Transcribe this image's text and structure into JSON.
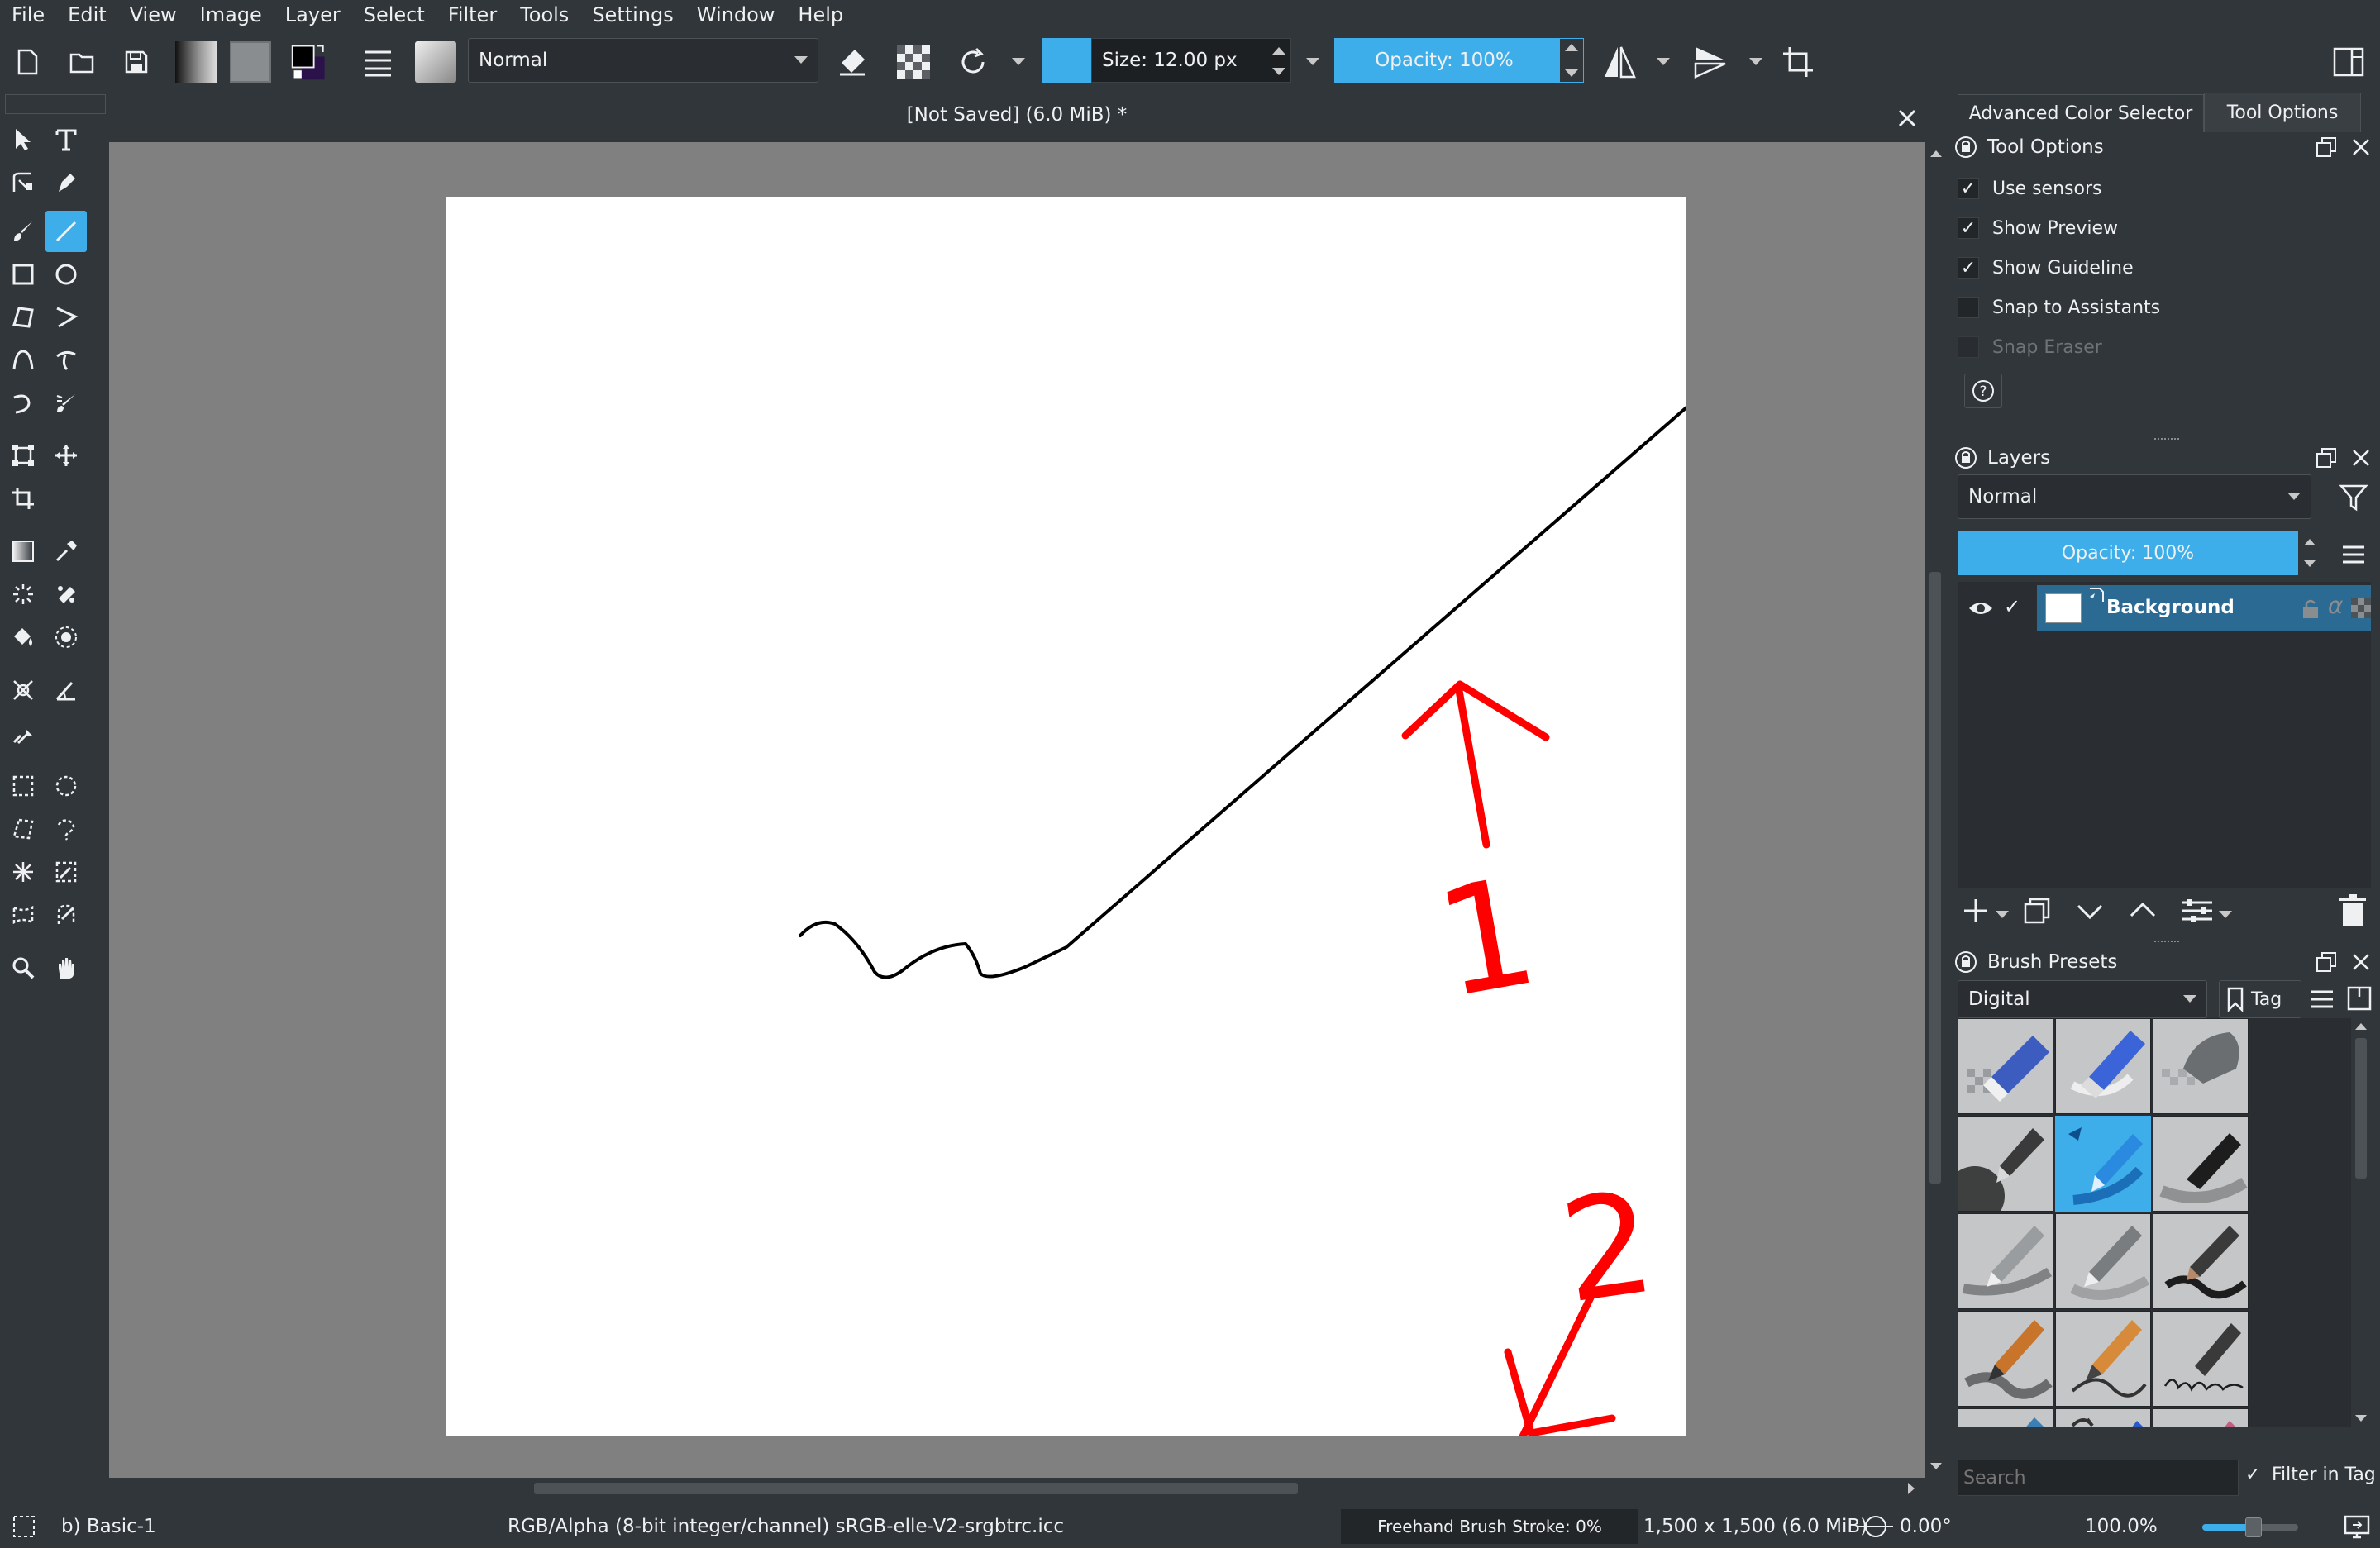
{
  "menu": [
    "File",
    "Edit",
    "View",
    "Image",
    "Layer",
    "Select",
    "Filter",
    "Tools",
    "Settings",
    "Window",
    "Help"
  ],
  "toolbar": {
    "blend_mode": "Normal",
    "size_label": "Size: 12.00 px",
    "opacity_label": "Opacity: 100%",
    "accent": "#3daee9"
  },
  "document": {
    "title": "[Not Saved]  (6.0 MiB) *",
    "annotations": [
      "1",
      "2"
    ],
    "annotation_color": "#ff0000"
  },
  "dock_tabs": [
    "Advanced Color Selector",
    "Tool Options"
  ],
  "tool_options": {
    "title": "Tool Options",
    "options": [
      {
        "label": "Use sensors",
        "checked": true
      },
      {
        "label": "Show Preview",
        "checked": true
      },
      {
        "label": "Show Guideline",
        "checked": true
      },
      {
        "label": "Snap to Assistants",
        "checked": false
      },
      {
        "label": "Snap Eraser",
        "checked": false
      }
    ],
    "help_glyph": "?"
  },
  "layers": {
    "title": "Layers",
    "blend_mode": "Normal",
    "opacity_label": "Opacity:  100%",
    "items": [
      {
        "name": "Background",
        "alpha_glyph": "α"
      }
    ]
  },
  "brush_presets": {
    "title": "Brush Presets",
    "tag_filter": "Digital",
    "tag_button": "Tag",
    "search_placeholder": "Search",
    "filter_in_tag": "Filter in Tag"
  },
  "status": {
    "brush": "b) Basic-1",
    "color_model": "RGB/Alpha (8-bit integer/channel)  sRGB-elle-V2-srgbtrc.icc",
    "stroke": "Freehand Brush Stroke: 0%",
    "dimensions": "1,500 x 1,500 (6.0 MiB)",
    "rotation": "0.00°",
    "zoom": "100.0%"
  }
}
